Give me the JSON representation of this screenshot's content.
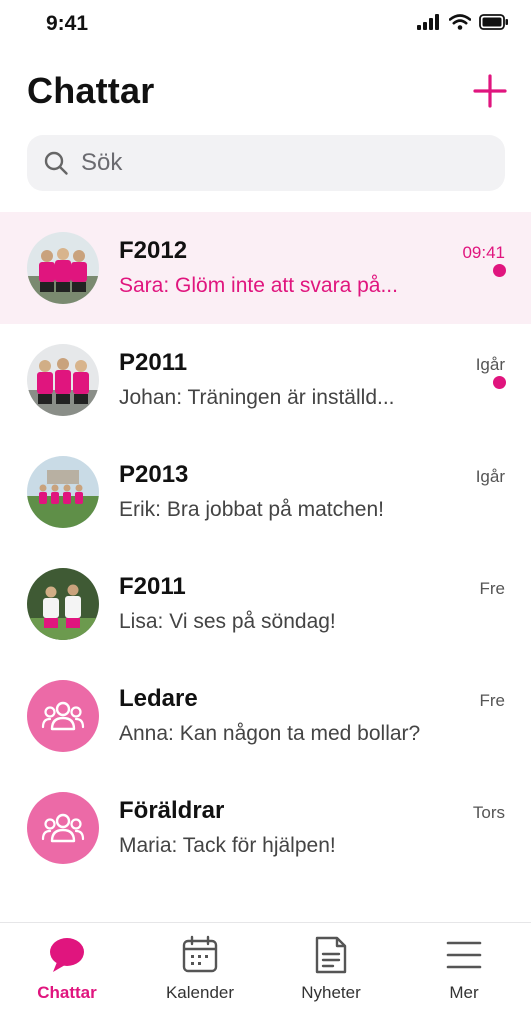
{
  "status_bar": {
    "time": "9:41"
  },
  "header": {
    "title": "Chattar"
  },
  "search": {
    "placeholder": "Sök"
  },
  "chats": [
    {
      "name": "F2012",
      "preview": "Sara: Glöm inte att svara på...",
      "time": "09:41",
      "unread": true,
      "active": true,
      "avatar": "team-photo"
    },
    {
      "name": "P2011",
      "preview": "Johan: Träningen är inställd...",
      "time": "Igår",
      "unread": true,
      "active": false,
      "avatar": "team-photo"
    },
    {
      "name": "P2013",
      "preview": "Erik: Bra jobbat på matchen!",
      "time": "Igår",
      "unread": false,
      "active": false,
      "avatar": "team-photo"
    },
    {
      "name": "F2011",
      "preview": "Lisa: Vi ses på söndag!",
      "time": "Fre",
      "unread": false,
      "active": false,
      "avatar": "team-photo"
    },
    {
      "name": "Ledare",
      "preview": "Anna: Kan någon ta med bollar?",
      "time": "Fre",
      "unread": false,
      "active": false,
      "avatar": "group-icon"
    },
    {
      "name": "Föräldrar",
      "preview": "Maria: Tack för hjälpen!",
      "time": "Tors",
      "unread": false,
      "active": false,
      "avatar": "group-icon"
    }
  ],
  "tabs": [
    {
      "label": "Chattar",
      "icon": "chat-bubble-icon",
      "active": true
    },
    {
      "label": "Kalender",
      "icon": "calendar-icon",
      "active": false
    },
    {
      "label": "Nyheter",
      "icon": "news-icon",
      "active": false
    },
    {
      "label": "Mer",
      "icon": "menu-icon",
      "active": false
    }
  ],
  "colors": {
    "accent": "#e0157e",
    "active_row": "#fbeff5",
    "group_avatar": "#ec6aa7"
  }
}
